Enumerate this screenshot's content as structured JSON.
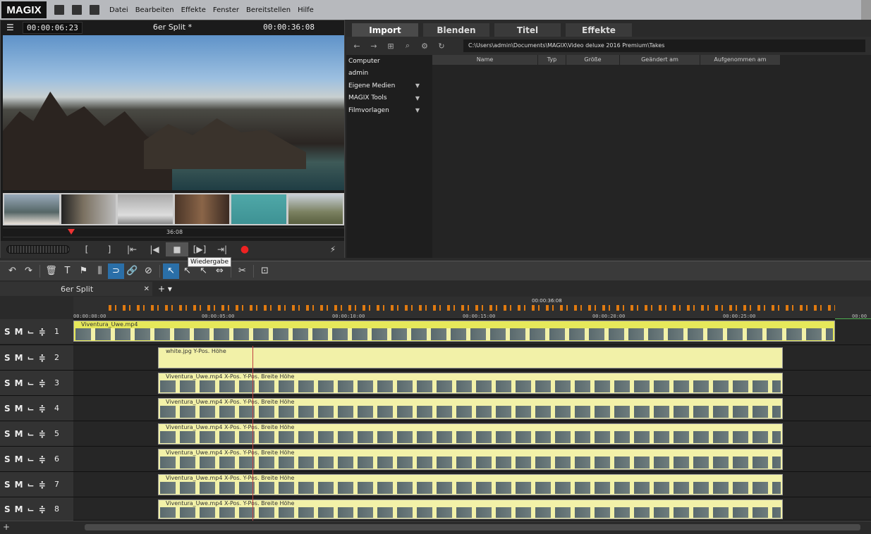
{
  "app": {
    "logo": "MAGIX"
  },
  "menu": [
    "Datei",
    "Bearbeiten",
    "Effekte",
    "Fenster",
    "Bereitstellen",
    "Hilfe"
  ],
  "preview": {
    "timecode_left": "00:00:06:23",
    "title": "6er Split *",
    "timecode_right": "00:00:36:08",
    "scrub_label": "36:08",
    "tooltip": "Wiedergabe",
    "playhead_fraction": 0.19
  },
  "pool": {
    "tabs": [
      "Import",
      "Blenden",
      "Titel",
      "Effekte"
    ],
    "active_tab": "Import",
    "path": "C:\\Users\\admin\\Documents\\MAGIX\\Video deluxe 2016 Premium\\Takes",
    "tree": [
      "Computer",
      "admin",
      "Eigene Medien",
      "MAGIX Tools",
      "Filmvorlagen"
    ],
    "columns": [
      "Name",
      "Typ",
      "Größe",
      "Geändert am",
      "Aufgenommen am"
    ]
  },
  "arrangement": {
    "tab": "6er Split",
    "ruler": {
      "start": "00:00:00:00",
      "ticks": [
        "00:00:05:00",
        "00:00:10:00",
        "00:00:15:00",
        "00:00:20:00",
        "00:00:25:00",
        "00:00"
      ],
      "position": "00:00:36:08"
    },
    "track_buttons": {
      "solo": "S",
      "mute": "M"
    },
    "tracks": [
      {
        "num": "1",
        "clip": "Viventura_Uwe.mp4"
      },
      {
        "num": "2",
        "clip": "white.jpg  Y-Pos.  Höhe"
      },
      {
        "num": "3",
        "clip": "Viventura_Uwe.mp4   X-Pos.  Y-Pos.  Breite  Höhe"
      },
      {
        "num": "4",
        "clip": "Viventura_Uwe.mp4   X-Pos.  Y-Pos.  Breite  Höhe"
      },
      {
        "num": "5",
        "clip": "Viventura_Uwe.mp4   X-Pos.  Y-Pos.  Breite  Höhe"
      },
      {
        "num": "6",
        "clip": "Viventura_Uwe.mp4   X-Pos.  Y-Pos.  Breite  Höhe"
      },
      {
        "num": "7",
        "clip": "Viventura_Uwe.mp4   X-Pos.  Y-Pos.  Breite  Höhe"
      },
      {
        "num": "8",
        "clip": "Viventura_Uwe.mp4   X-Pos.  Y-Pos.  Breite  Höhe"
      }
    ]
  },
  "colors": {
    "accent": "#2a6fa8",
    "clip": "#f2f1a8",
    "marker": "#e07a10",
    "record": "#e22222"
  }
}
